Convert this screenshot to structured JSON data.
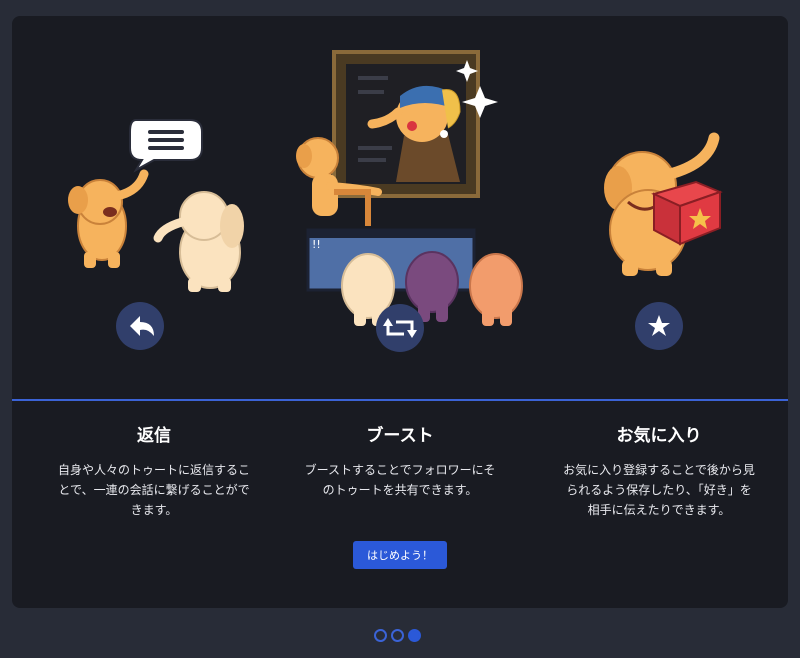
{
  "columns": [
    {
      "title": "返信",
      "desc_lines": [
        "自身や人々のトゥートに返信するこ",
        "とで、一連の会話に繋げることがで",
        "きます。"
      ],
      "icon": "reply-icon"
    },
    {
      "title": "ブースト",
      "desc_lines": [
        "ブーストすることでフォロワーにそ",
        "のトゥートを共有できます。"
      ],
      "icon": "boost-icon"
    },
    {
      "title": "お気に入り",
      "desc_lines": [
        "お気に入り登録することで後から見",
        "られるよう保存したり、「好き」を",
        "相手に伝えたりできます。"
      ],
      "icon": "star-icon"
    }
  ],
  "start_button": "はじめよう！",
  "pager": {
    "pages": 3,
    "active_index": 2
  },
  "colors": {
    "accent": "#2b59d8",
    "modal_bg": "#191b22",
    "page_bg": "#282c37",
    "mascot_orange": "#f6b35d",
    "icon_circle": "#313f6b"
  }
}
